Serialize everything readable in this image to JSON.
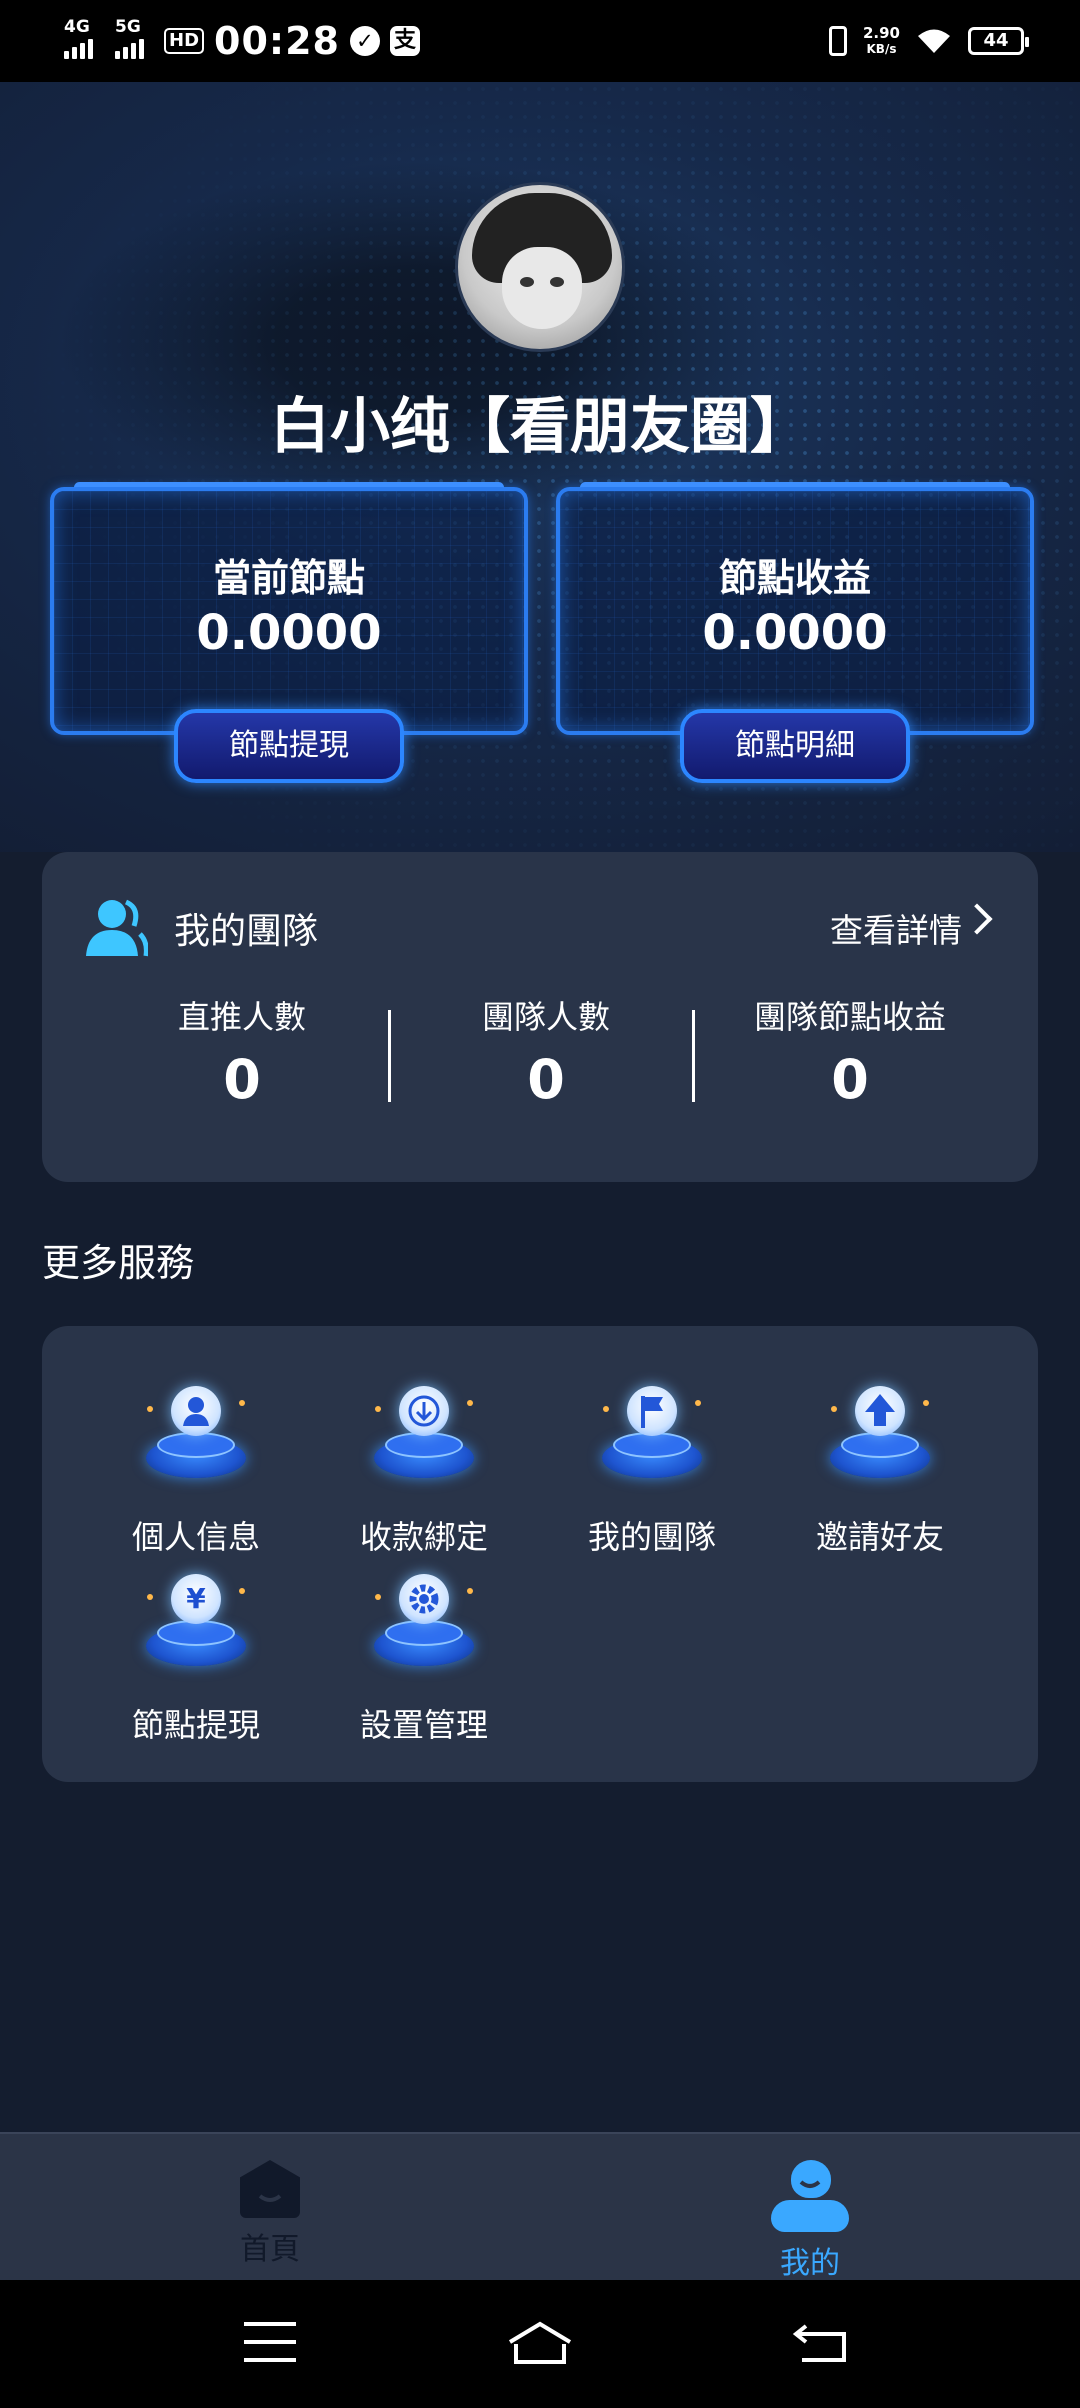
{
  "status_bar": {
    "net1": "4G",
    "net2": "5G",
    "hd": "HD",
    "time": "00:28",
    "speed_value": "2.90",
    "speed_unit": "KB/s",
    "battery": "44"
  },
  "profile": {
    "username": "白小纯【看朋友圈】"
  },
  "node_cards": [
    {
      "title": "當前節點",
      "value": "0.0000",
      "button": "節點提現"
    },
    {
      "title": "節點收益",
      "value": "0.0000",
      "button": "節點明細"
    }
  ],
  "team": {
    "title": "我的團隊",
    "link": "查看詳情",
    "stats": [
      {
        "label": "直推人數",
        "value": "0"
      },
      {
        "label": "團隊人數",
        "value": "0"
      },
      {
        "label": "團隊節點收益",
        "value": "0"
      }
    ]
  },
  "services": {
    "title": "更多服務",
    "items": [
      {
        "label": "個人信息",
        "icon": "user-icon"
      },
      {
        "label": "收款綁定",
        "icon": "download-icon"
      },
      {
        "label": "我的團隊",
        "icon": "flag-icon"
      },
      {
        "label": "邀請好友",
        "icon": "upload-arrow-icon"
      },
      {
        "label": "節點提現",
        "icon": "yen-coin-icon"
      },
      {
        "label": "設置管理",
        "icon": "gear-icon"
      }
    ]
  },
  "tabbar": {
    "items": [
      {
        "label": "首頁",
        "icon": "home-icon",
        "active": false
      },
      {
        "label": "我的",
        "icon": "profile-icon",
        "active": true
      }
    ],
    "active_color": "#3aa8ff",
    "inactive_color": "#11192a"
  }
}
